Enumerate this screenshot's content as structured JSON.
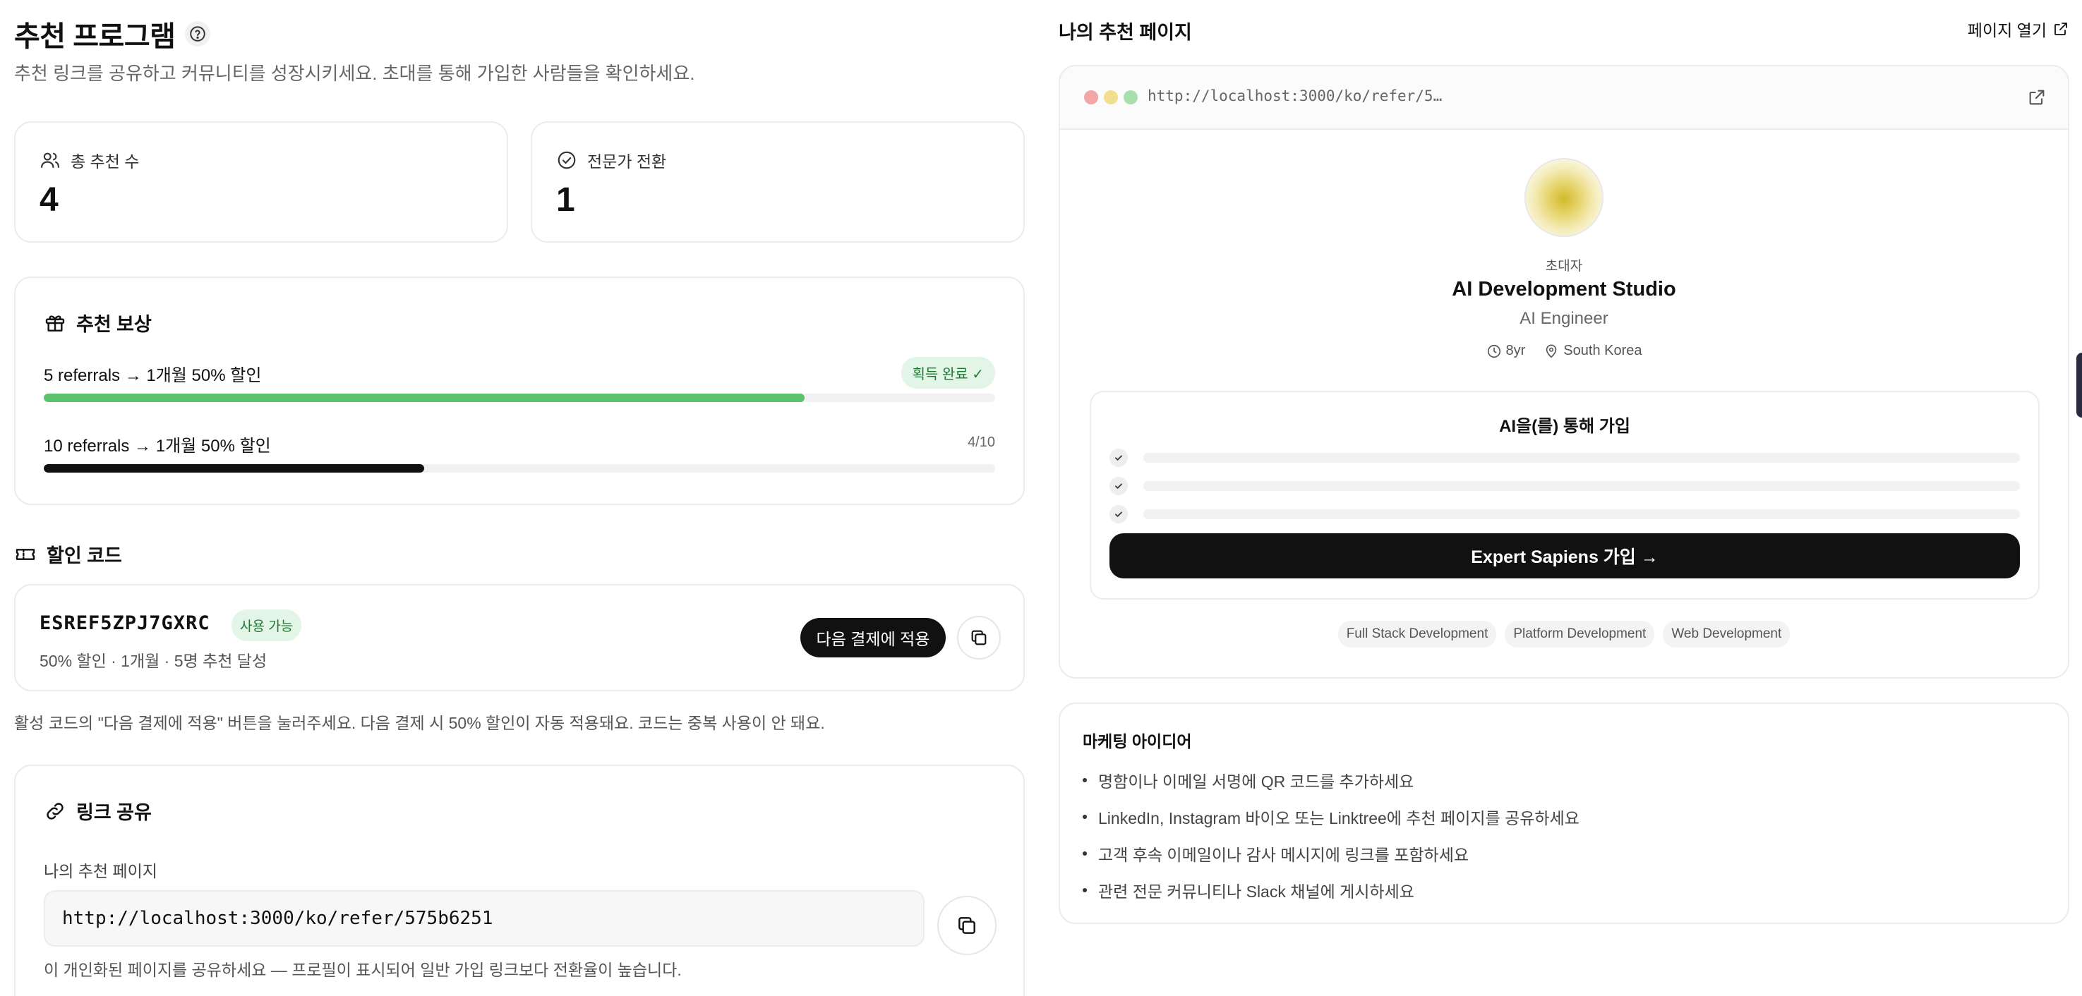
{
  "header": {
    "title": "추천 프로그램",
    "subtitle": "추천 링크를 공유하고 커뮤니티를 성장시키세요. 초대를 통해 가입한 사람들을 확인하세요."
  },
  "stats": [
    {
      "label": "총 추천 수",
      "value": "4",
      "icon": "users-icon"
    },
    {
      "label": "전문가 전환",
      "value": "1",
      "icon": "check-circle-icon"
    }
  ],
  "rewards": {
    "heading": "추천 보상",
    "items": [
      {
        "label": "5 referrals → 1개월 50% 할인",
        "status": "획득 완료 ✓",
        "progress": 0.8
      },
      {
        "label": "10 referrals → 1개월 50% 할인",
        "status": "4/10",
        "progress": 0.4
      }
    ]
  },
  "discount": {
    "heading": "할인 코드",
    "code": "ESREF5ZPJ7GXRC",
    "badge": "사용 가능",
    "description": "50% 할인 · 1개월 · 5명 추천 달성",
    "apply_label": "다음 결제에 적용",
    "note": "활성 코드의 \"다음 결제에 적용\" 버튼을 눌러주세요. 다음 결제 시 50% 할인이 자동 적용돼요. 코드는 중복 사용이 안 돼요."
  },
  "share": {
    "heading": "링크 공유",
    "field_label": "나의 추천 페이지",
    "url": "http://localhost:3000/ko/refer/575b6251",
    "note": "이 개인화된 페이지를 공유하세요 — 프로필이 표시되어 일반 가입 링크보다 전환율이 높습니다."
  },
  "preview": {
    "title": "나의 추천 페이지",
    "open_label": "페이지 열기",
    "browser_url": "http://localhost:3000/ko/refer/5…",
    "inviter_label": "초대자",
    "name": "AI Development Studio",
    "role": "AI Engineer",
    "experience": "8yr",
    "location": "South Korea",
    "join_title": "AI을(를) 통해 가입",
    "join_button": "Expert Sapiens 가입 →",
    "tags": [
      "Full Stack Development",
      "Platform Development",
      "Web Development"
    ]
  },
  "marketing": {
    "title": "마케팅 아이디어",
    "tips": [
      "명함이나 이메일 서명에 QR 코드를 추가하세요",
      "LinkedIn, Instagram 바이오 또는 Linktree에 추천 페이지를 공유하세요",
      "고객 후속 이메일이나 감사 메시지에 링크를 포함하세요",
      "관련 전문 커뮤니티나 Slack 채널에 게시하세요"
    ]
  },
  "colors": {
    "accent": "#111111",
    "success": "#5cc26b",
    "success_bg": "#e3f5e6",
    "success_text": "#1c7a34"
  }
}
